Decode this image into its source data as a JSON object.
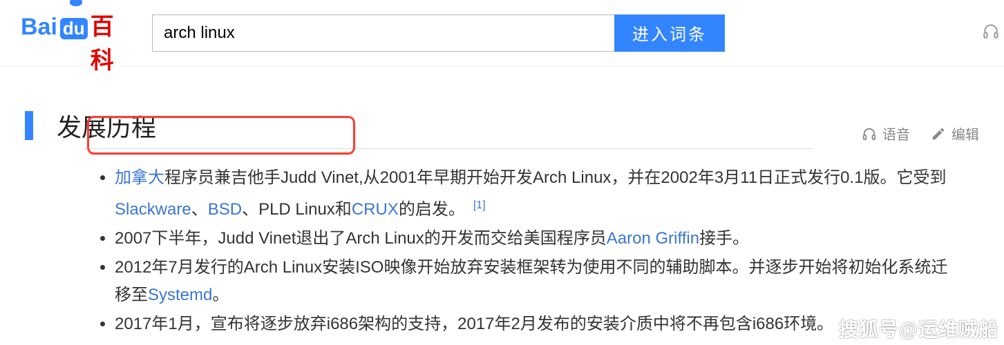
{
  "header": {
    "logo": {
      "bai": "Bai",
      "du": "du",
      "baike": "百科"
    },
    "search": {
      "value": "arch linux"
    },
    "button_label": "进入词条"
  },
  "section": {
    "title": "发展历程",
    "actions": {
      "voice": "语音",
      "edit": "编辑"
    }
  },
  "links": {
    "canada": "加拿大",
    "slackware": "Slackware",
    "bsd": "BSD",
    "crux": "CRUX",
    "aaron": "Aaron Griffin",
    "systemd": "Systemd"
  },
  "text": {
    "li1a": "程序员兼吉他手Judd Vinet,从2001年早期开始开发Arch Linux，并在2002年3月11日正式发行0.1版。它受到",
    "li1b": "、",
    "li1c": "、PLD Linux和",
    "li1d": "的启发。",
    "ref1": "[1]",
    "li2a": "2007下半年，Judd Vinet退出了Arch Linux的开发而交给美国程序员",
    "li2b": "接手。",
    "li3a": "2012年7月发行的Arch Linux安装ISO映像开始放弃安装框架转为使用不同的辅助脚本。并逐步开始将初始化系统迁移至",
    "li3b": "。",
    "li4": "2017年1月，宣布将逐步放弃i686架构的支持，2017年2月发布的安装介质中将不再包含i686环境。"
  },
  "watermark": "搜狐号@运维贼船"
}
